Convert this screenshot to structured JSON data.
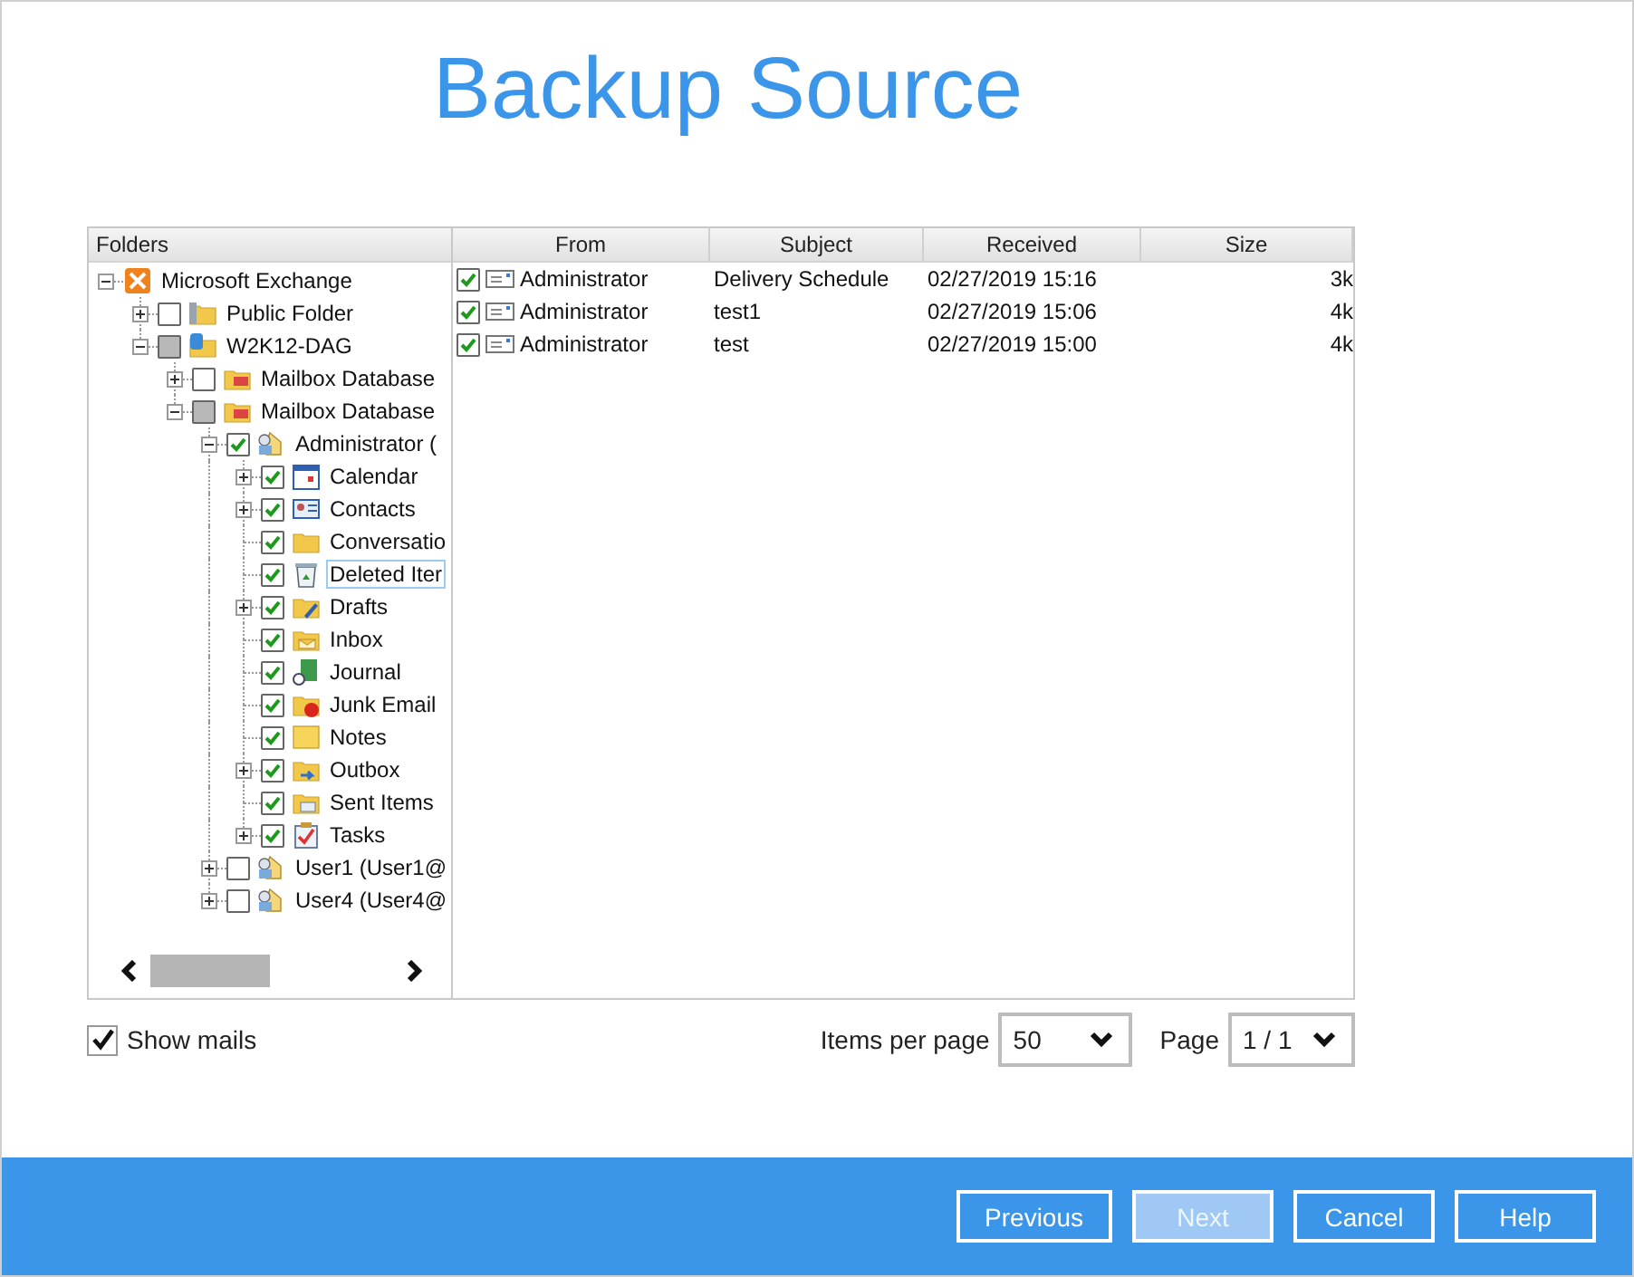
{
  "title": "Backup Source",
  "tree": {
    "header": "Folders",
    "items": [
      {
        "label": "Microsoft Exchange",
        "kind": "exchange",
        "expanded": true,
        "selected": false,
        "children": [
          {
            "label": "Public Folder",
            "kind": "public-folder",
            "checked": false,
            "partial": false,
            "expanded": false,
            "selected": false
          },
          {
            "label": "W2K12-DAG",
            "kind": "dag",
            "checked": false,
            "partial": true,
            "expanded": true,
            "selected": false,
            "children": [
              {
                "label": "Mailbox Database",
                "kind": "database",
                "checked": false,
                "partial": false,
                "expanded": false,
                "selected": false
              },
              {
                "label": "Mailbox Database",
                "kind": "database",
                "checked": false,
                "partial": true,
                "expanded": true,
                "selected": false,
                "children": [
                  {
                    "label": "Administrator (",
                    "kind": "mailbox",
                    "checked": true,
                    "partial": false,
                    "expanded": true,
                    "selected": false,
                    "children": [
                      {
                        "label": "Calendar",
                        "kind": "calendar",
                        "checked": true,
                        "partial": false,
                        "expanded": false,
                        "selected": false
                      },
                      {
                        "label": "Contacts",
                        "kind": "contacts",
                        "checked": true,
                        "partial": false,
                        "expanded": false,
                        "selected": false
                      },
                      {
                        "label": "Conversatio",
                        "kind": "folder",
                        "checked": true,
                        "partial": false,
                        "selected": false
                      },
                      {
                        "label": "Deleted Iter",
                        "kind": "trash",
                        "checked": true,
                        "partial": false,
                        "selected": true
                      },
                      {
                        "label": "Drafts",
                        "kind": "drafts",
                        "checked": true,
                        "partial": false,
                        "expanded": false,
                        "selected": false
                      },
                      {
                        "label": "Inbox",
                        "kind": "inbox",
                        "checked": true,
                        "partial": false,
                        "selected": false
                      },
                      {
                        "label": "Journal",
                        "kind": "journal",
                        "checked": true,
                        "partial": false,
                        "selected": false
                      },
                      {
                        "label": "Junk Email",
                        "kind": "junk",
                        "checked": true,
                        "partial": false,
                        "selected": false
                      },
                      {
                        "label": "Notes",
                        "kind": "notes",
                        "checked": true,
                        "partial": false,
                        "selected": false
                      },
                      {
                        "label": "Outbox",
                        "kind": "outbox",
                        "checked": true,
                        "partial": false,
                        "expanded": false,
                        "selected": false
                      },
                      {
                        "label": "Sent Items",
                        "kind": "sent",
                        "checked": true,
                        "partial": false,
                        "selected": false
                      },
                      {
                        "label": "Tasks",
                        "kind": "tasks",
                        "checked": true,
                        "partial": false,
                        "expanded": false,
                        "selected": false
                      }
                    ]
                  },
                  {
                    "label": "User1 (User1@",
                    "kind": "mailbox",
                    "checked": false,
                    "partial": false,
                    "expanded": false,
                    "selected": false
                  },
                  {
                    "label": "User4 (User4@",
                    "kind": "mailbox",
                    "checked": false,
                    "partial": false,
                    "expanded": false,
                    "selected": false
                  }
                ]
              }
            ]
          }
        ]
      }
    ]
  },
  "table": {
    "columns": [
      "From",
      "Subject",
      "Received",
      "Size"
    ],
    "rows": [
      {
        "checked": true,
        "from": "Administrator",
        "subject": "Delivery Schedule",
        "received": "02/27/2019 15:16",
        "size": "3k"
      },
      {
        "checked": true,
        "from": "Administrator",
        "subject": "test1",
        "received": "02/27/2019 15:06",
        "size": "4k"
      },
      {
        "checked": true,
        "from": "Administrator",
        "subject": "test",
        "received": "02/27/2019 15:00",
        "size": "4k"
      }
    ]
  },
  "show_mails": {
    "label": "Show mails",
    "checked": true
  },
  "items_per_page": {
    "label": "Items per page",
    "value": "50"
  },
  "page": {
    "label": "Page",
    "value": "1 / 1"
  },
  "buttons": [
    {
      "label": "Previous",
      "disabled": false
    },
    {
      "label": "Next",
      "disabled": true
    },
    {
      "label": "Cancel",
      "disabled": false
    },
    {
      "label": "Help",
      "disabled": false
    }
  ]
}
